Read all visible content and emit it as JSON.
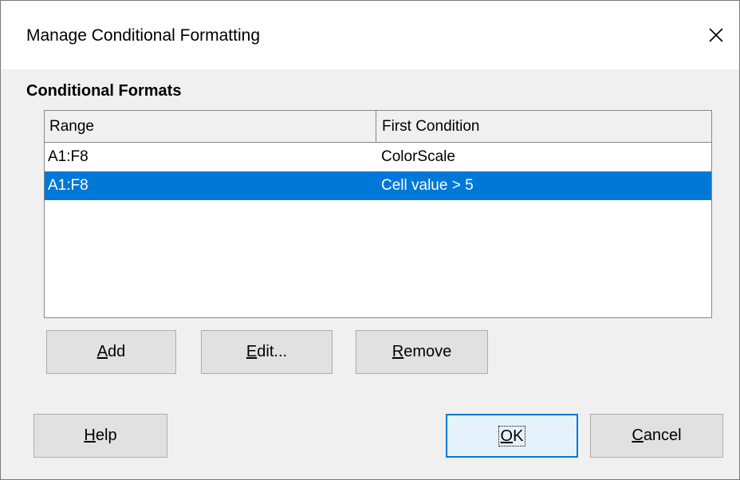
{
  "dialog": {
    "title": "Manage Conditional Formatting",
    "close_icon": "close-icon"
  },
  "section": {
    "heading": "Conditional Formats"
  },
  "list": {
    "columns": [
      "Range",
      "First Condition"
    ],
    "rows": [
      {
        "range": "A1:F8",
        "condition": "ColorScale",
        "selected": false
      },
      {
        "range": "A1:F8",
        "condition": "Cell value > 5",
        "selected": true
      }
    ],
    "selected_color": "#0078d7"
  },
  "buttons": {
    "add": {
      "mnemonic": "A",
      "rest": "dd"
    },
    "edit": {
      "mnemonic": "E",
      "rest": "dit..."
    },
    "remove": {
      "mnemonic": "R",
      "rest": "emove"
    },
    "help": {
      "mnemonic": "H",
      "rest": "elp"
    },
    "ok": {
      "mnemonic": "O",
      "rest": "K"
    },
    "cancel": {
      "mnemonic": "C",
      "rest": "ancel"
    }
  }
}
